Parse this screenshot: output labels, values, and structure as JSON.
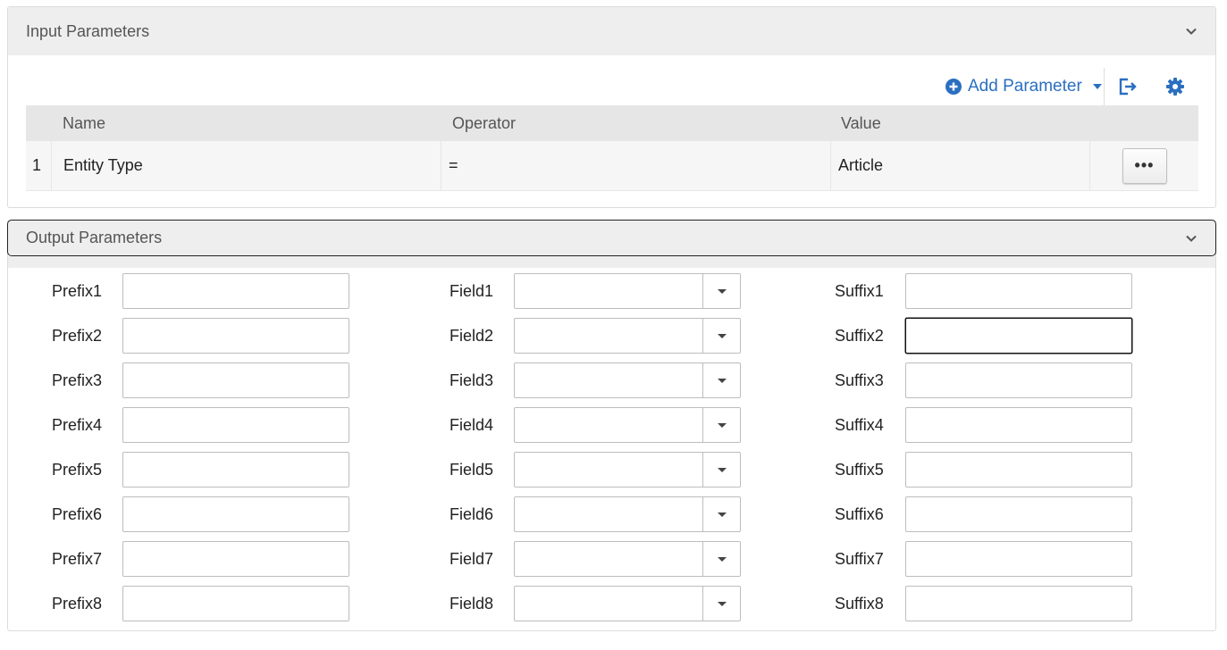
{
  "input_panel": {
    "title": "Input Parameters",
    "toolbar": {
      "add_parameter_label": "Add Parameter"
    },
    "table": {
      "headers": {
        "name": "Name",
        "operator": "Operator",
        "value": "Value"
      },
      "rows": [
        {
          "index": "1",
          "name": "Entity Type",
          "operator": "=",
          "value": "Article",
          "actions_label": "•••"
        }
      ]
    }
  },
  "output_panel": {
    "title": "Output Parameters",
    "rows": [
      {
        "prefix_label": "Prefix1",
        "prefix_value": "",
        "field_label": "Field1",
        "field_value": "",
        "suffix_label": "Suffix1",
        "suffix_value": ""
      },
      {
        "prefix_label": "Prefix2",
        "prefix_value": "",
        "field_label": "Field2",
        "field_value": "",
        "suffix_label": "Suffix2",
        "suffix_value": ""
      },
      {
        "prefix_label": "Prefix3",
        "prefix_value": "",
        "field_label": "Field3",
        "field_value": "",
        "suffix_label": "Suffix3",
        "suffix_value": ""
      },
      {
        "prefix_label": "Prefix4",
        "prefix_value": "",
        "field_label": "Field4",
        "field_value": "",
        "suffix_label": "Suffix4",
        "suffix_value": ""
      },
      {
        "prefix_label": "Prefix5",
        "prefix_value": "",
        "field_label": "Field5",
        "field_value": "",
        "suffix_label": "Suffix5",
        "suffix_value": ""
      },
      {
        "prefix_label": "Prefix6",
        "prefix_value": "",
        "field_label": "Field6",
        "field_value": "",
        "suffix_label": "Suffix6",
        "suffix_value": ""
      },
      {
        "prefix_label": "Prefix7",
        "prefix_value": "",
        "field_label": "Field7",
        "field_value": "",
        "suffix_label": "Suffix7",
        "suffix_value": ""
      },
      {
        "prefix_label": "Prefix8",
        "prefix_value": "",
        "field_label": "Field8",
        "field_value": "",
        "suffix_label": "Suffix8",
        "suffix_value": ""
      }
    ]
  },
  "colors": {
    "accent": "#2a6fc0",
    "header_bg": "#eeeeee",
    "row_bg": "#f5f6f5"
  },
  "icons": {
    "collapse": "chevron-down-icon",
    "add": "plus-circle-icon",
    "export": "export-icon",
    "settings": "gear-icon"
  }
}
